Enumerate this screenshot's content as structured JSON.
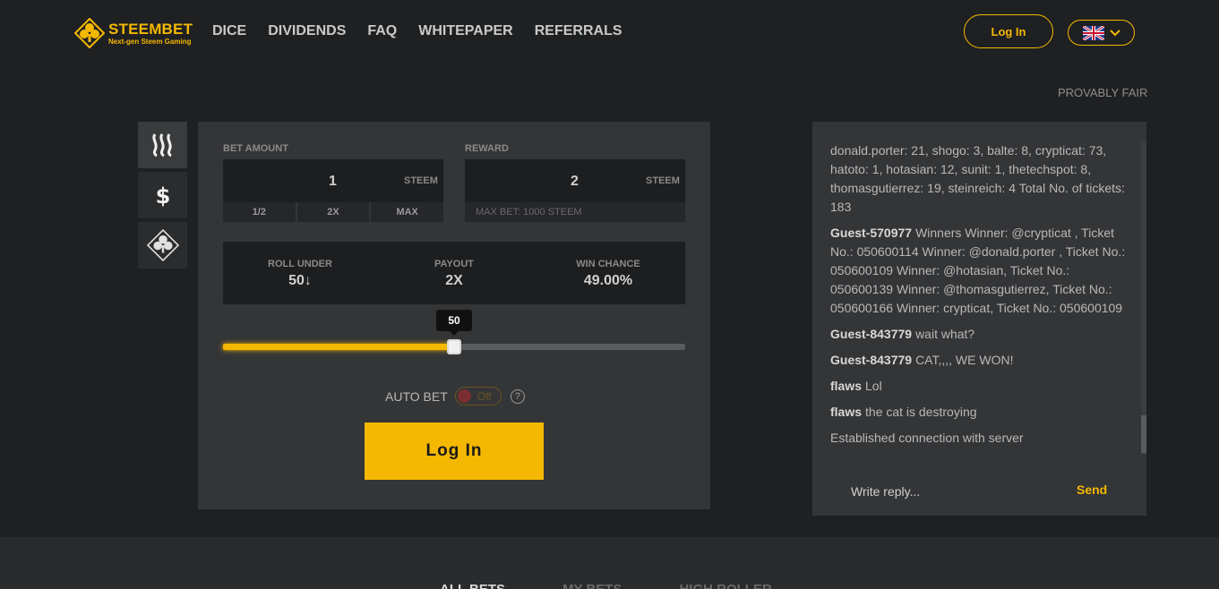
{
  "header": {
    "logo_title": "STEEMBET",
    "logo_subtitle": "Next-gen Steem Gaming",
    "nav": [
      "DICE",
      "DIVIDENDS",
      "FAQ",
      "WHITEPAPER",
      "REFERRALS"
    ],
    "login_label": "Log In",
    "provably_fair": "PROVABLY FAIR"
  },
  "bet": {
    "bet_amount_label": "BET AMOUNT",
    "bet_amount_value": "1",
    "bet_unit": "STEEM",
    "half": "1/2",
    "double": "2X",
    "max": "MAX",
    "reward_label": "REWARD",
    "reward_value": "2",
    "reward_unit": "STEEM",
    "max_bet": "MAX BET: 1000 STEEM"
  },
  "stats": {
    "roll_under_label": "ROLL UNDER",
    "roll_under_value": "50↓",
    "payout_label": "PAYOUT",
    "payout_value": "2X",
    "win_chance_label": "WIN CHANCE",
    "win_chance_value": "49.00%"
  },
  "slider": {
    "value": "50",
    "fraction": 0.5
  },
  "autobet": {
    "label": "AUTO BET",
    "state": "Off",
    "help": "?"
  },
  "login_button": "Log In",
  "chat": {
    "messages": [
      {
        "user": "",
        "text": "donald.porter: 21, shogo: 3, balte: 8, crypticat: 73, hatoto: 1, hotasian: 12, sunit: 1, thetechspot: 8, thomasgutierrez: 19, steinreich: 4 Total No. of tickets: 183"
      },
      {
        "user": "Guest-570977",
        "text": "Winners Winner: @crypticat , Ticket No.: 050600114 Winner: @donald.porter , Ticket No.: 050600109 Winner: @hotasian, Ticket No.: 050600139 Winner: @thomasgutierrez, Ticket No.: 050600166 Winner: crypticat, Ticket No.: 050600109"
      },
      {
        "user": "Guest-843779",
        "text": "wait what?"
      },
      {
        "user": "Guest-843779",
        "text": "CAT,,,, WE WON!"
      },
      {
        "user": "flaws",
        "text": "Lol"
      },
      {
        "user": "flaws",
        "text": "the cat is destroying"
      },
      {
        "user": "",
        "text": "Established connection with server"
      }
    ],
    "reply_placeholder": "Write reply...",
    "send": "Send"
  },
  "footer_tabs": [
    "ALL BETS",
    "MY BETS",
    "HIGH ROLLER"
  ],
  "colors": {
    "accent": "#f5b800",
    "bg": "#1f2022",
    "panel": "#343537"
  }
}
